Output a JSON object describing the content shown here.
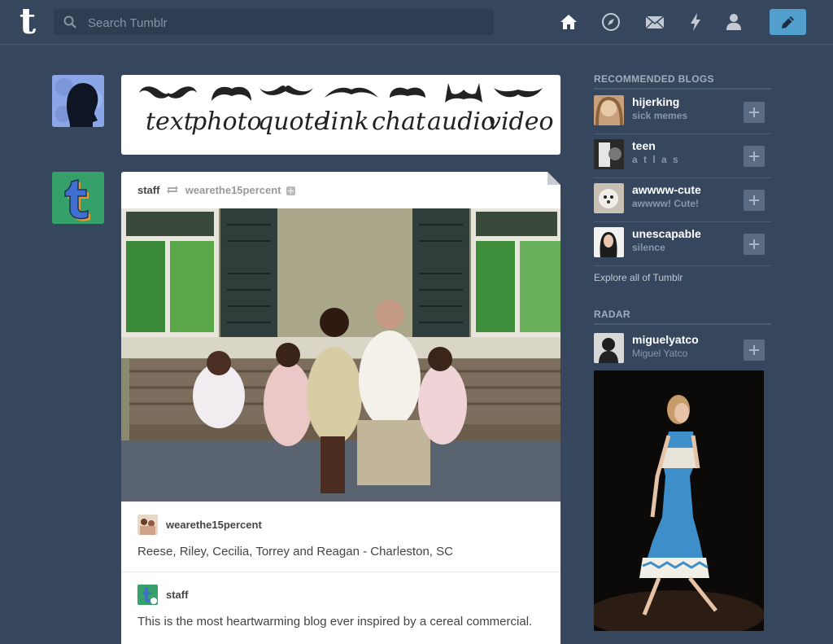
{
  "header": {
    "search_placeholder": "Search Tumblr",
    "logo_text": "t",
    "nav_icons": [
      "home-icon",
      "explore-icon",
      "inbox-icon",
      "activity-icon",
      "account-icon"
    ],
    "compose_icon": "pencil-icon",
    "accent_color": "#529ecc"
  },
  "post_types": {
    "labels": [
      "text",
      "photo",
      "quote",
      "link",
      "chat",
      "audio",
      "video"
    ]
  },
  "post": {
    "author": "staff",
    "reblogged_from": "wearethe15percent",
    "source_name": "wearethe15percent",
    "caption": "Reese, Riley, Cecilia, Torrey and Reagan - Charleston, SC",
    "commenter": "staff",
    "body": "This is the most heartwarming blog ever inspired by a cereal commercial."
  },
  "sidebar": {
    "recommended_title": "RECOMMENDED BLOGS",
    "blogs": [
      {
        "name": "hijerking",
        "subtitle": "sick memes"
      },
      {
        "name": "teen",
        "subtitle": "a t l a s"
      },
      {
        "name": "awwww-cute",
        "subtitle": "awwww! Cute!"
      },
      {
        "name": "unescapable",
        "subtitle": "silence"
      }
    ],
    "explore_label": "Explore all of Tumblr",
    "radar_title": "RADAR",
    "radar": {
      "name": "miguelyatco",
      "subtitle": "Miguel Yatco"
    }
  }
}
